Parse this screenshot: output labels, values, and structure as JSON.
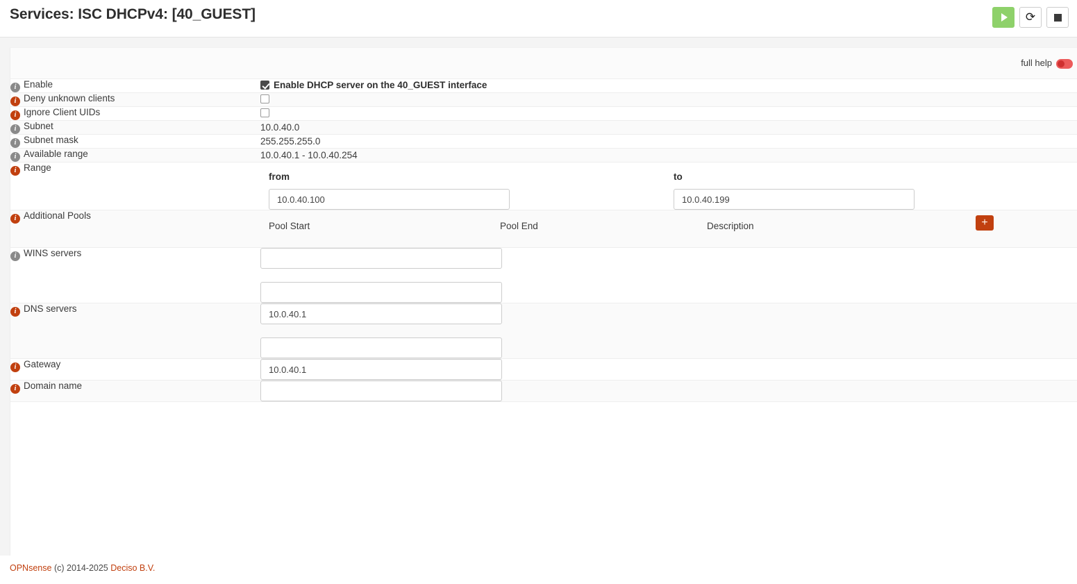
{
  "header": {
    "title": "Services: ISC DHCPv4: [40_GUEST]",
    "actions": [
      {
        "name": "start-service-button",
        "icon": "play-icon",
        "label": ""
      },
      {
        "name": "restart-service-button",
        "icon": "restart-icon",
        "label": "⟳"
      },
      {
        "name": "stop-service-button",
        "icon": "stop-icon",
        "label": ""
      }
    ]
  },
  "help": {
    "label": "full help",
    "enabled": false,
    "color": "#ec5b5b"
  },
  "form": {
    "rows": [
      {
        "label": "Enable",
        "info": "gray",
        "type": "checkbox",
        "checked": true,
        "checkbox_label": "Enable DHCP server on the 40_GUEST interface"
      },
      {
        "label": "Deny unknown clients",
        "info": "orange",
        "type": "checkbox",
        "checked": false,
        "checkbox_label": ""
      },
      {
        "label": "Ignore Client UIDs",
        "info": "orange",
        "type": "checkbox",
        "checked": false,
        "checkbox_label": ""
      },
      {
        "label": "Subnet",
        "info": "gray",
        "type": "static",
        "value": "10.0.40.0"
      },
      {
        "label": "Subnet mask",
        "info": "gray",
        "type": "static",
        "value": "255.255.255.0"
      },
      {
        "label": "Available range",
        "info": "gray",
        "type": "static",
        "value": "10.0.40.1 - 10.0.40.254"
      },
      {
        "label": "Range",
        "info": "orange",
        "type": "range",
        "from_label": "from",
        "to_label": "to",
        "from_value": "10.0.40.100",
        "to_value": "10.0.40.199"
      },
      {
        "label": "Additional Pools",
        "info": "orange",
        "type": "pools",
        "columns": [
          "Pool Start",
          "Pool End",
          "Description"
        ],
        "add_label": "+",
        "add_color": "#c1400f"
      },
      {
        "label": "WINS servers",
        "info": "gray",
        "type": "multi-input",
        "values": [
          "",
          ""
        ]
      },
      {
        "label": "DNS servers",
        "info": "orange",
        "type": "multi-input",
        "values": [
          "10.0.40.1",
          ""
        ]
      },
      {
        "label": "Gateway",
        "info": "orange",
        "type": "input",
        "value": "10.0.40.1"
      },
      {
        "label": "Domain name",
        "info": "orange",
        "type": "input",
        "value": ""
      }
    ]
  },
  "footer": {
    "brand": "OPNsense",
    "copyright": "(c) 2014-2025",
    "vendor": "Deciso B.V.",
    "link_color": "#c1400f"
  }
}
